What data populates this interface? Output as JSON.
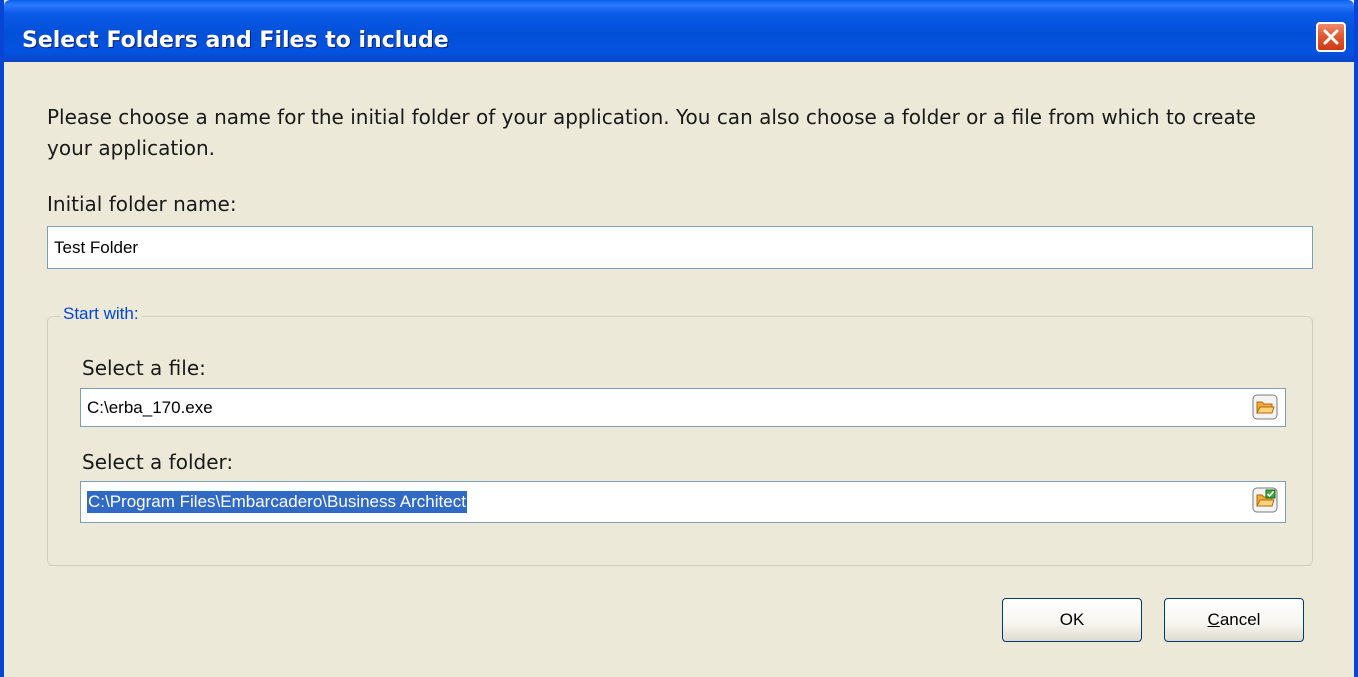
{
  "window": {
    "title": "Select Folders and Files to include"
  },
  "intro_text": "Please choose a name for the initial folder of your application. You can also choose a folder or a file from which to create your application.",
  "initial_folder": {
    "label": "Initial folder name:",
    "value": "Test Folder"
  },
  "start_with": {
    "legend": "Start with:",
    "file": {
      "label": "Select a file:",
      "value": "C:\\erba_170.exe",
      "browse_icon": "open-folder-icon"
    },
    "folder": {
      "label": "Select a folder:",
      "value": "C:\\Program Files\\Embarcadero\\Business Architect",
      "browse_icon": "open-folder-check-icon"
    }
  },
  "buttons": {
    "ok": "OK",
    "cancel_first": "C",
    "cancel_rest": "ancel"
  },
  "colors": {
    "titlebar": "#0a5ae8",
    "legend": "#0046d5",
    "selection": "#316ac5"
  }
}
